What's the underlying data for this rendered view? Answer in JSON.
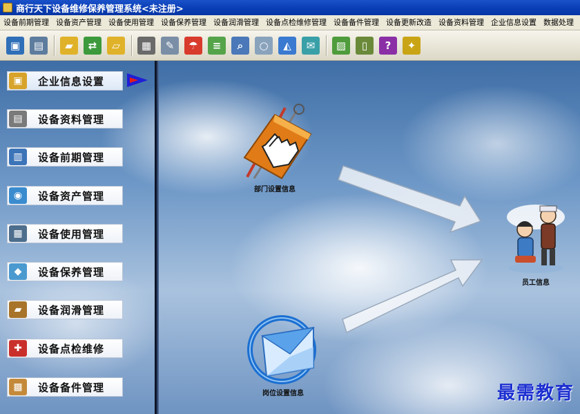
{
  "window": {
    "title": "商行天下设备维修保养管理系统<未注册>"
  },
  "menu": [
    "设备前期管理",
    "设备资产管理",
    "设备使用管理",
    "设备保养管理",
    "设备润滑管理",
    "设备点检维修管理",
    "设备备件管理",
    "设备更新改造",
    "设备资料管理",
    "企业信息设置",
    "数据处理"
  ],
  "toolbar": {
    "buttons": [
      {
        "icon": "monitor-icon",
        "color": "#2f6fb8",
        "glyph": "▣"
      },
      {
        "icon": "printer-icon",
        "color": "#5d7c9e",
        "glyph": "▤"
      },
      {
        "icon": "folder-icon",
        "color": "#e0b22a",
        "glyph": "▰"
      },
      {
        "icon": "exchange-icon",
        "color": "#3c9a3c",
        "glyph": "⇄"
      },
      {
        "icon": "folder-open-icon",
        "color": "#e0b22a",
        "glyph": "▱"
      },
      {
        "icon": "film-icon",
        "color": "#6a6a6a",
        "glyph": "▦"
      },
      {
        "icon": "tools-icon",
        "color": "#7a8ea6",
        "glyph": "✎"
      },
      {
        "icon": "umbrella-icon",
        "color": "#d83a2c",
        "glyph": "☂"
      },
      {
        "icon": "ledger-icon",
        "color": "#55a44a",
        "glyph": "≡"
      },
      {
        "icon": "magnifier-document-icon",
        "color": "#4a78b8",
        "glyph": "⌕"
      },
      {
        "icon": "search-icon",
        "color": "#8aa3bd",
        "glyph": "○"
      },
      {
        "icon": "bell-icon",
        "color": "#3a7ad0",
        "glyph": "◭"
      },
      {
        "icon": "envelope-icon",
        "color": "#3aa0a8",
        "glyph": "✉"
      },
      {
        "icon": "picture-icon",
        "color": "#4f9c3c",
        "glyph": "▨"
      },
      {
        "icon": "mobile-icon",
        "color": "#6a8a3a",
        "glyph": "▯"
      },
      {
        "icon": "help-book-icon",
        "color": "#8a2fa6",
        "glyph": "?"
      },
      {
        "icon": "exit-runner-icon",
        "color": "#c9a516",
        "glyph": "✦"
      }
    ]
  },
  "sidebar": {
    "items": [
      {
        "label": "企业信息设置",
        "icon": "lock-icon",
        "color": "#d7a32a",
        "glyph": "▣",
        "selected": true
      },
      {
        "label": "设备资料管理",
        "icon": "book-icon",
        "color": "#7a7a7a",
        "glyph": "▤",
        "selected": false
      },
      {
        "label": "设备前期管理",
        "icon": "chart-icon",
        "color": "#3c74b8",
        "glyph": "▥",
        "selected": false
      },
      {
        "label": "设备资产管理",
        "icon": "globe-icon",
        "color": "#3a8ccf",
        "glyph": "◉",
        "selected": false
      },
      {
        "label": "设备使用管理",
        "icon": "computer-icon",
        "color": "#4d6e8c",
        "glyph": "▦",
        "selected": false
      },
      {
        "label": "设备保养管理",
        "icon": "toolbox-icon",
        "color": "#4a9ad0",
        "glyph": "◆",
        "selected": false
      },
      {
        "label": "设备润滑管理",
        "icon": "folder-icon",
        "color": "#a8742a",
        "glyph": "▰",
        "selected": false
      },
      {
        "label": "设备点检维修",
        "icon": "drill-icon",
        "color": "#c9302c",
        "glyph": "✚",
        "selected": false
      },
      {
        "label": "设备备件管理",
        "icon": "box-icon",
        "color": "#c48a3a",
        "glyph": "▩",
        "selected": false
      }
    ]
  },
  "diagram": {
    "nodes": {
      "department": {
        "label": "部门设置信息"
      },
      "position": {
        "label": "岗位设置信息"
      },
      "employee": {
        "label": "员工信息"
      }
    }
  },
  "watermark": "最需教育"
}
